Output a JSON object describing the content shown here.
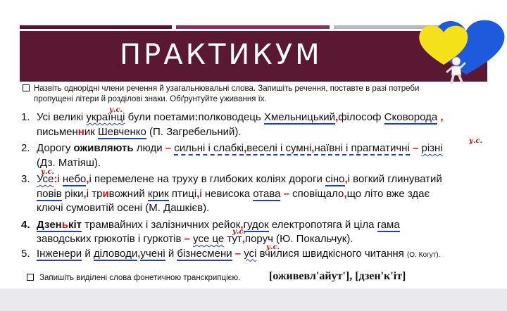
{
  "slide_title": "ПРАКТИКУМ",
  "task1": {
    "line1": "Назвіть однорідні члени речення й узагальнювальні слова. Запишіть речення, поставте в разі потреби",
    "line2": "пропущені літери й розділові знаки. Обґрунтуйте уживання їх."
  },
  "mark_label": "у.с.",
  "sentences": {
    "s1": {
      "num": "1.",
      "a": "Усі великі ",
      "b": "українці",
      "c": " були поетами",
      "d": ":",
      "e": "полководець ",
      "f": "Хмельницький",
      "g": ",",
      "h": "філософ ",
      "i": "Сковорода",
      "j": " ,",
      "k": "письмен",
      "l": "н",
      "m": "ик ",
      "n": "Шевченко",
      "o": " (П. Загребельний)."
    },
    "s2": {
      "num": "2.",
      "a": "Дорогу ",
      "b": "оживляють",
      "c": " люди ",
      "d": "–",
      "e": "  ",
      "f": "сильні і слабкі",
      "g": ",",
      "h": "веселі і сумні",
      "i": ",",
      "j": "наївні і прагматичні",
      "k": "  –  ",
      "l": "різні",
      "m": "(Дз. Матіяш)."
    },
    "s3": {
      "num": "3.",
      "a": "Усе",
      "b": ":",
      "c": "і ",
      "d": "небо",
      "e": ",",
      "f": "і перемелене на труху в глибоких коліях дороги ",
      "g": "сіно",
      "h": ",",
      "i": "і вогкий глинуватий",
      "j": "повів",
      "k": " ріки",
      "l": ",",
      "m": "і тр",
      "n": "и",
      "o": "вожний ",
      "p": "крик",
      "q": " птиці",
      "r": ",",
      "s": "і невисока ",
      "t": "отава",
      "u": " – ",
      "v": "сповіщало",
      "w": ",",
      "x": "що літо вже здає",
      "y": "ключі сумовитій осені (М. Дашкієв)."
    },
    "s4": {
      "num": "4.",
      "a": "Дзен",
      "b": "ь",
      "c": "кіт",
      "d": " трамвайних і залізничних рейок",
      "e": ",",
      "f": "гудок",
      "g": " електропотяга й ціла ",
      "h": "гама",
      "i": "заводських грюкотів і гуркотів ",
      "j": " – ",
      "k": "усе це",
      "l": " тут",
      "m": ",",
      "n": "поруч (Ю. Покальчук)."
    },
    "s5": {
      "num": "5.",
      "a": "Інженери",
      "b": " й ",
      "c": "діловоди",
      "d": ",",
      "e": "учені",
      "f": " й ",
      "g": "бізнесмени",
      "h": " – ",
      "i": "усі",
      "j": " вчилися швидкісного читання ",
      "k": "(О. Когут)."
    }
  },
  "task2": "Запишіть виділені слова фонетичною транскрипцією.",
  "transcription": "[оживевл'айут'], [дзен'к'іт]",
  "colors": {
    "banner": "#5a1832",
    "underline": "#1f3fbf",
    "red_mark": "#c01010",
    "heart_blue": "#1e5adc",
    "heart_yellow": "#f5e11a"
  }
}
